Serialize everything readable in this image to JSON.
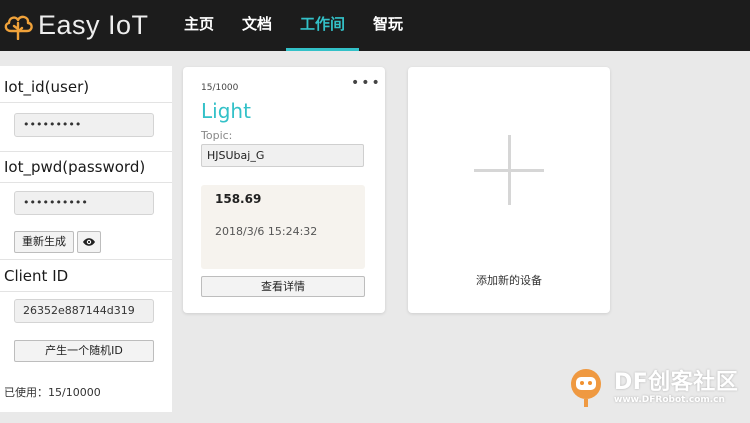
{
  "app": {
    "brand": "Easy IoT"
  },
  "nav": {
    "items": [
      {
        "label": "主页"
      },
      {
        "label": "文档"
      },
      {
        "label": "工作间"
      },
      {
        "label": "智玩"
      }
    ],
    "active_index": 2
  },
  "sidebar": {
    "iot_id_title": "Iot_id(user)",
    "iot_id_value": "•••••••••",
    "iot_pwd_title": "Iot_pwd(password)",
    "iot_pwd_value": "••••••••••",
    "regenerate_label": "重新生成",
    "client_id_title": "Client ID",
    "client_id_value": "26352e887144d319",
    "random_id_label": "产生一个随机ID",
    "used_text": "已使用：15/10000"
  },
  "device_card": {
    "counter": "15/1000",
    "menu_glyph": "•••",
    "name": "Light",
    "topic_label": "Topic:",
    "topic_value": "HJSUbaj_G",
    "value": "158.69",
    "datetime": "2018/3/6 15:24:32",
    "detail_label": "查看详情"
  },
  "add_card": {
    "label": "添加新的设备"
  },
  "watermark": {
    "brand": "DF创客社区",
    "url": "www.DFRobot.com.cn"
  },
  "colors": {
    "accent": "#33c1c8",
    "topbar": "#1c1c1c",
    "logo_orange": "#f0a23a",
    "watermark": "#f0902f"
  },
  "icons": {
    "logo": "cloud-tree-icon",
    "show_password": "eye-icon",
    "add_device": "plus-icon",
    "card_menu": "more-dots-icon"
  }
}
